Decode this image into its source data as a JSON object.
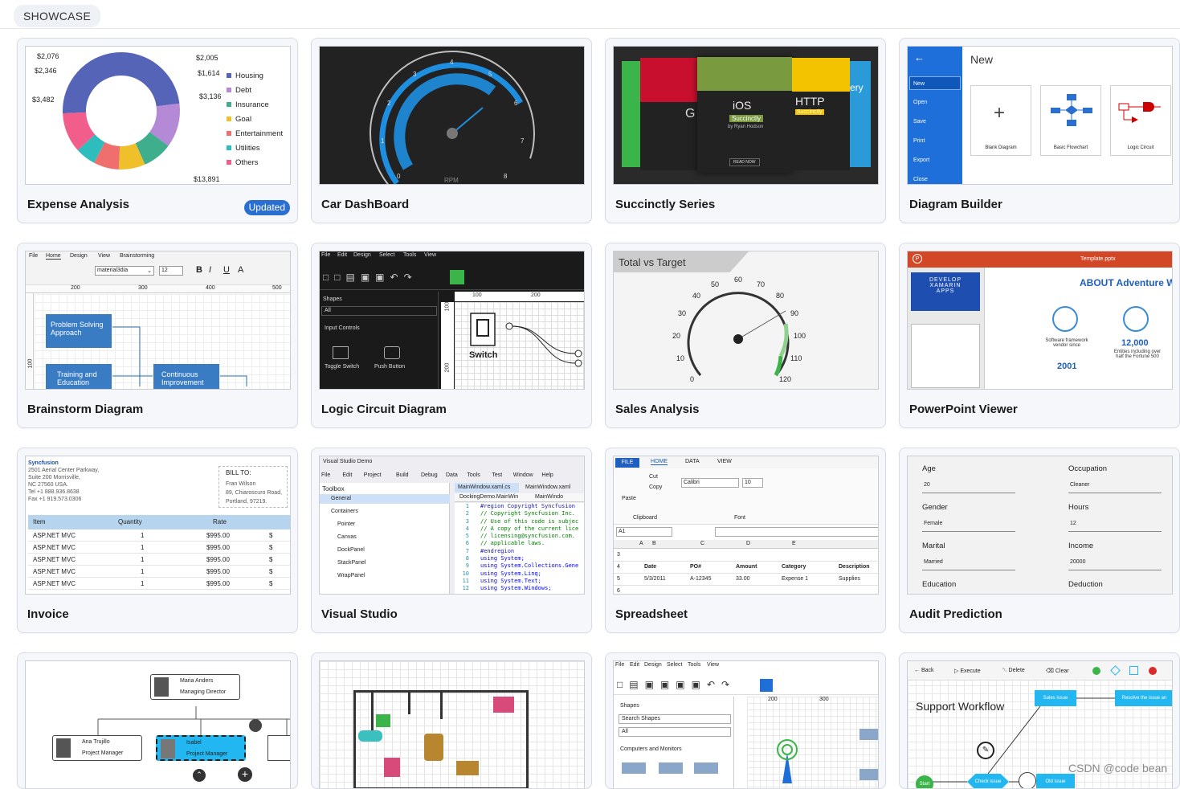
{
  "header": {
    "tab": "SHOWCASE"
  },
  "watermark": "CSDN @code bean",
  "colors": {
    "accent": "#2a6fcf",
    "diagram_blue": "#1e6fd9",
    "office_red": "#d24726",
    "gauge_green": "#3bb54a"
  },
  "cards": [
    {
      "title": "Expense Analysis",
      "badge": "Updated"
    },
    {
      "title": "Car DashBoard"
    },
    {
      "title": "Succinctly Series"
    },
    {
      "title": "Diagram Builder"
    },
    {
      "title": "Brainstorm Diagram"
    },
    {
      "title": "Logic Circuit Diagram"
    },
    {
      "title": "Sales Analysis"
    },
    {
      "title": "PowerPoint Viewer"
    },
    {
      "title": "Invoice"
    },
    {
      "title": "Visual Studio"
    },
    {
      "title": "Spreadsheet"
    },
    {
      "title": "Audit Prediction"
    }
  ],
  "expense": {
    "labels": [
      "$2,076",
      "$2,005",
      "$2,346",
      "$1,614",
      "$3,482",
      "$3,136",
      "$13,891"
    ],
    "legend": [
      "Housing",
      "Debt",
      "Insurance",
      "Goal",
      "Entertainment",
      "Utilities",
      "Others"
    ],
    "slices": [
      {
        "name": "Others",
        "value": 13891,
        "color": "#5664b8"
      },
      {
        "name": "Debt",
        "value": 3482,
        "color": "#b48ad6"
      },
      {
        "name": "Insurance",
        "value": 2346,
        "color": "#3fae8c"
      },
      {
        "name": "Goal",
        "value": 2076,
        "color": "#f0c02a"
      },
      {
        "name": "Entertainment",
        "value": 2005,
        "color": "#ef6f6f"
      },
      {
        "name": "Utilities",
        "value": 1614,
        "color": "#2fbcbc"
      },
      {
        "name": "Housing",
        "value": 3136,
        "color": "#f25e8c"
      }
    ]
  },
  "car": {
    "ticks": [
      "0",
      "1",
      "2",
      "3",
      "4",
      "5",
      "6",
      "7",
      "8"
    ],
    "unit": "RPM",
    "value": 5.3
  },
  "succinctly": {
    "book1": "G",
    "book2": "iOS",
    "book2_tag": "Succinctly",
    "book2_author": "by Ryan Hodson",
    "book2_btn": "READ NOW",
    "book3": "HTTP",
    "book3_tag": "Succinctly",
    "book4": "ery"
  },
  "diagram_builder": {
    "menu": [
      "New",
      "Open",
      "Save",
      "Print",
      "Export",
      "Close"
    ],
    "heading": "New",
    "templates": [
      "Blank Diagram",
      "Basic Flowchart",
      "Logic Circuit"
    ]
  },
  "brainstorm": {
    "tabs": [
      "File",
      "Home",
      "Design",
      "View",
      "Brainstorming"
    ],
    "font": "material3dia",
    "size": "12",
    "ruler": [
      "200",
      "300",
      "400",
      "500"
    ],
    "vruler": "100",
    "nodes": [
      "Problem Solving Approach",
      "Training and Education",
      "Continuous Improvement"
    ]
  },
  "logic": {
    "menu": [
      "File",
      "Edit",
      "Design",
      "Select",
      "Tools",
      "View"
    ],
    "panel": "Shapes",
    "filter": "All",
    "group": "Input Controls",
    "items": [
      "Toggle Switch",
      "Push Button"
    ],
    "switch_label": "Switch",
    "ruler": [
      "100",
      "200"
    ],
    "vruler": [
      "100",
      "200"
    ]
  },
  "sales": {
    "title": "Total vs Target",
    "ticks": [
      "0",
      "10",
      "20",
      "30",
      "40",
      "50",
      "60",
      "70",
      "80",
      "90",
      "100",
      "110",
      "120"
    ],
    "value": 92
  },
  "ppt": {
    "filename": "Template.pptx",
    "slide_title": "ABOUT Adventure W",
    "left_title": "DEVELOP XAMARIN APPS",
    "stat1_label": "Software framework vendor since",
    "stat1_value": "2001",
    "stat2_value": "12,000",
    "stat2_label": "Entities including over half the Fortune 500"
  },
  "invoice": {
    "company": "Syncfusion",
    "address": [
      "2501 Aerial Center Parkway,",
      "Suite 200 Morrisville,",
      "NC 27560 USA.",
      "Tel +1 888.936.8638",
      "Fax +1 919.573.0306"
    ],
    "bill_to": "BILL TO:",
    "bill": [
      "Fran Wilson",
      "89, Chiaroscuro Road,",
      "Portland, 97219."
    ],
    "headers": [
      "Item",
      "Quantity",
      "Rate"
    ],
    "rows": [
      [
        "ASP.NET MVC",
        "1",
        "$995.00",
        "$"
      ],
      [
        "ASP.NET MVC",
        "1",
        "$995.00",
        "$"
      ],
      [
        "ASP.NET MVC",
        "1",
        "$995.00",
        "$"
      ],
      [
        "ASP.NET MVC",
        "1",
        "$995.00",
        "$"
      ],
      [
        "ASP.NET MVC",
        "1",
        "$995.00",
        "$"
      ]
    ]
  },
  "vs": {
    "title": "Visual Studio Demo",
    "menu": [
      "File",
      "Edit",
      "Project",
      "Build",
      "Debug",
      "Data",
      "Tools",
      "Test",
      "Window",
      "Help"
    ],
    "toolbox": "Toolbox",
    "general": "General",
    "containers": "Containers",
    "tools": [
      "Pointer",
      "Canvas",
      "DockPanel",
      "StackPanel",
      "WrapPanel"
    ],
    "tabs": [
      "MainWindow.xaml.cs",
      "MainWindow.xaml"
    ],
    "crumbs": [
      "DockingDemo.MainWin",
      "MainWindo"
    ],
    "code": [
      "#region Copyright Syncfusion",
      "// Copyright Syncfusion Inc.",
      "// Use of this code is subjec",
      "// A copy of the current lice",
      "// licensing@syncfusion.com.",
      "// applicable laws.",
      "#endregion",
      "using System;",
      "using System.Collections.Gene",
      "using System.Linq;",
      "using System.Text;",
      "using System.Windows;"
    ]
  },
  "sheet": {
    "tabs": [
      "FILE",
      "HOME",
      "DATA",
      "VIEW"
    ],
    "clip": [
      "Cut",
      "Copy",
      "Paste",
      "Clipboard"
    ],
    "font": "Calibri",
    "size": "10",
    "font_group": "Font",
    "cell": "A1",
    "cols": [
      "A",
      "B",
      "C",
      "D",
      "E"
    ],
    "rows": [
      "3",
      "4",
      "5",
      "6"
    ],
    "headers": [
      "Date",
      "PO#",
      "Amount",
      "Category",
      "Description"
    ],
    "row1": [
      "5/3/2011",
      "A-12345",
      "33.00",
      "Expense 1",
      "Supplies"
    ]
  },
  "audit": {
    "fields": [
      {
        "label": "Age",
        "value": "20"
      },
      {
        "label": "Occupation",
        "value": "Cleaner"
      },
      {
        "label": "Gender",
        "value": "Female"
      },
      {
        "label": "Hours",
        "value": "12"
      },
      {
        "label": "Marital",
        "value": "Married"
      },
      {
        "label": "Income",
        "value": "20000"
      },
      {
        "label": "Education",
        "value": ""
      },
      {
        "label": "Deduction",
        "value": ""
      }
    ]
  },
  "org": {
    "top_name": "Maria Anders",
    "top_role": "Managing Director",
    "left_name": "Ana Trujillo",
    "left_role": "Project Manager",
    "mid_name": "Isabel",
    "mid_role": "Project Manager"
  },
  "diagram2": {
    "menu": [
      "File",
      "Edit",
      "Design",
      "Select",
      "Tools",
      "View"
    ],
    "panel": "Shapes",
    "search": "Search Shapes",
    "filter": "All",
    "group": "Computers and Monitors",
    "ruler": [
      "200",
      "300"
    ]
  },
  "workflow": {
    "toolbar": [
      "Back",
      "Execute",
      "Delete",
      "Clear"
    ],
    "title": "Support Workflow",
    "nodes": [
      "Sales issue",
      "Resolve the issue an",
      "Start",
      "Check issue",
      "Old issue"
    ]
  }
}
